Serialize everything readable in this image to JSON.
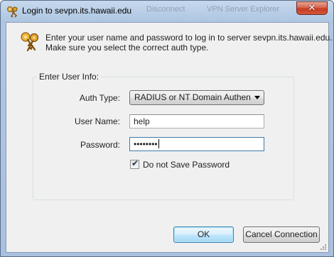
{
  "window": {
    "title": "Login to sevpn.its.hawaii.edu",
    "close_symbol": "✕",
    "bg_text_left": "Disconnect",
    "bg_text_right": "VPN Server Explorer"
  },
  "intro": {
    "line1": "Enter your user name and password to log in to server sevpn.its.hawaii.edu.",
    "line2": "Make sure you select the correct auth type."
  },
  "group": {
    "legend": "Enter User Info:",
    "auth_type_label": "Auth Type:",
    "auth_type_value": "RADIUS or NT Domain Authentication",
    "user_name_label": "User Name:",
    "user_name_value": "help",
    "password_label": "Password:",
    "password_value": "••••••••",
    "save_password_label": "Do not Save Password",
    "save_password_checked": true
  },
  "buttons": {
    "ok": "OK",
    "cancel": "Cancel Connection"
  },
  "icons": {
    "title": "keys-icon",
    "header": "keys-icon",
    "close": "close-icon",
    "dropdown": "chevron-down-icon"
  }
}
